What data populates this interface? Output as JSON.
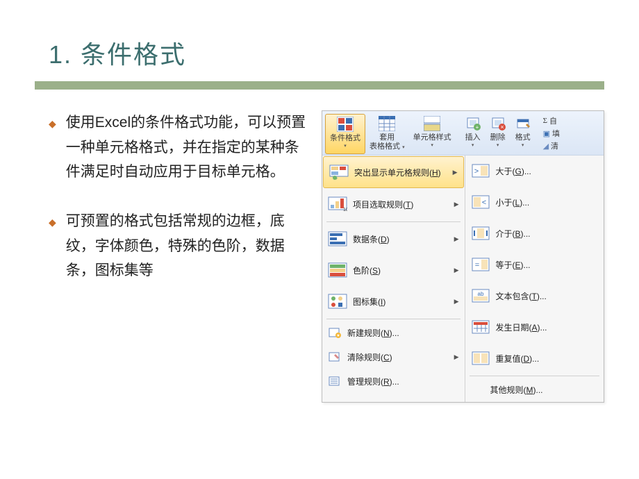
{
  "title": "1. 条件格式",
  "bullets": [
    "使用Excel的条件格式功能，可以预置一种单元格格式，并在指定的某种条件满足时自动应用于目标单元格。",
    "可预置的格式包括常规的边框，底纹，字体颜色，特殊的色阶，数据条，图标集等"
  ],
  "ribbon": {
    "conditional_format": "条件格式",
    "table_format_top": "套用",
    "table_format_bottom": "表格格式",
    "cell_styles": "单元格样式",
    "insert": "插入",
    "delete": "删除",
    "format": "格式",
    "sigma": "Σ",
    "auto": "自",
    "fill": "填",
    "clear": "清"
  },
  "menu_left": {
    "highlight_rules": "突出显示单元格规则(H)",
    "top_rules": "项目选取规则(T)",
    "data_bars": "数据条(D)",
    "color_scales": "色阶(S)",
    "icon_sets": "图标集(I)",
    "new_rule": "新建规则(N)...",
    "clear_rules": "清除规则(C)",
    "manage_rules": "管理规则(R)..."
  },
  "menu_right": {
    "greater": "大于(G)...",
    "less": "小于(L)...",
    "between": "介于(B)...",
    "equal": "等于(E)...",
    "text_contains": "文本包含(T)...",
    "date_occurs": "发生日期(A)...",
    "duplicate": "重复值(D)...",
    "more_rules": "其他规则(M)..."
  }
}
